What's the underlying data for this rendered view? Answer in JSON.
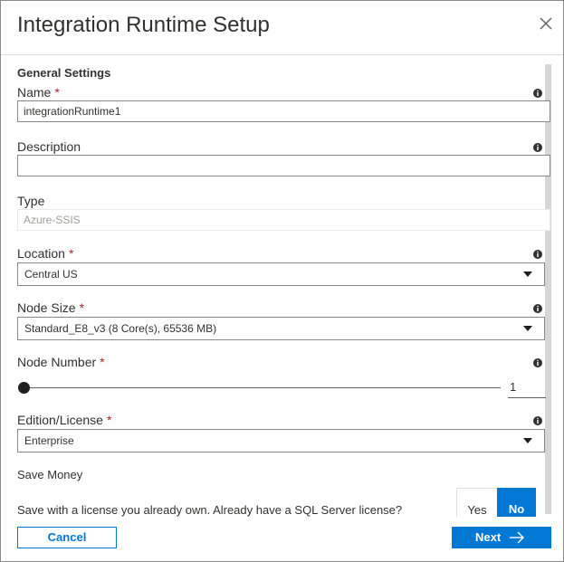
{
  "dialog": {
    "title": "Integration Runtime Setup",
    "close_icon": "close-icon"
  },
  "section": {
    "title": "General Settings"
  },
  "fields": {
    "name": {
      "label": "Name",
      "required": "*",
      "value": "integrationRuntime1"
    },
    "description": {
      "label": "Description",
      "value": ""
    },
    "type": {
      "label": "Type",
      "value": "Azure-SSIS"
    },
    "location": {
      "label": "Location",
      "required": "*",
      "value": "Central US"
    },
    "node_size": {
      "label": "Node Size",
      "required": "*",
      "value": "Standard_E8_v3 (8 Core(s), 65536 MB)"
    },
    "node_number": {
      "label": "Node Number",
      "required": "*",
      "value": "1",
      "slider_fraction": 0
    },
    "edition": {
      "label": "Edition/License",
      "required": "*",
      "value": "Enterprise"
    }
  },
  "save_money": {
    "label": "Save Money",
    "question": "Save with a license you already own. Already have a SQL Server license?",
    "yes_label": "Yes",
    "no_label": "No",
    "selected": "No"
  },
  "footer": {
    "cancel_label": "Cancel",
    "next_label": "Next"
  },
  "colors": {
    "accent": "#0078d4",
    "required": "#a4262c",
    "border": "#8a8886"
  }
}
